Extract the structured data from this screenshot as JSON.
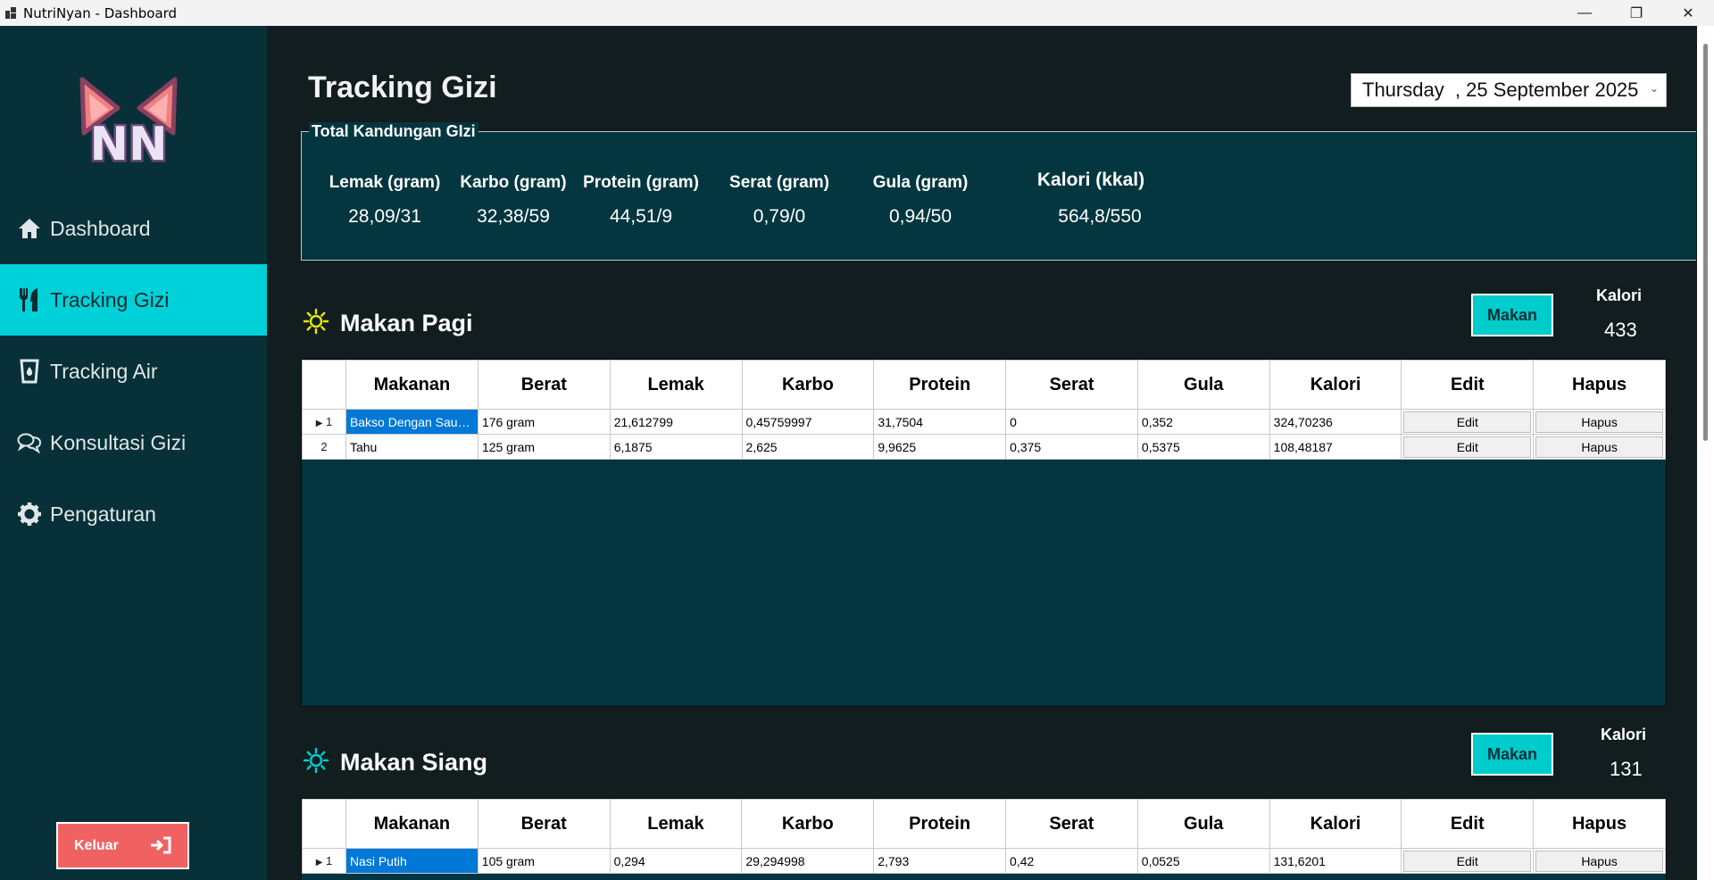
{
  "window": {
    "title": "NutriNyan - Dashboard",
    "minimize": "—",
    "maximize": "❐",
    "close": "✕"
  },
  "sidebar": {
    "logo_text": "NN",
    "items": [
      {
        "label": "Dashboard",
        "icon": "home-icon",
        "active": false
      },
      {
        "label": "Tracking Gizi",
        "icon": "utensils-icon",
        "active": true
      },
      {
        "label": "Tracking Air",
        "icon": "water-glass-icon",
        "active": false
      },
      {
        "label": "Konsultasi Gizi",
        "icon": "chat-icon",
        "active": false
      },
      {
        "label": "Pengaturan",
        "icon": "gear-icon",
        "active": false
      }
    ],
    "logout_label": "Keluar"
  },
  "main": {
    "title": "Tracking Gizi",
    "date": "Thursday  , 25 September 2025",
    "totals": {
      "legend": "Total Kandungan GIzi",
      "columns": [
        {
          "label": "Lemak (gram)",
          "value": "28,09/31"
        },
        {
          "label": "Karbo (gram)",
          "value": "32,38/59"
        },
        {
          "label": "Protein (gram)",
          "value": "44,51/9"
        },
        {
          "label": "Serat (gram)",
          "value": "0,79/0"
        },
        {
          "label": "Gula (gram)",
          "value": "0,94/50"
        },
        {
          "label": "Kalori (kkal)",
          "value": "564,8/550"
        }
      ]
    },
    "table_headers": [
      "Makanan",
      "Berat",
      "Lemak",
      "Karbo",
      "Protein",
      "Serat",
      "Gula",
      "Kalori",
      "Edit",
      "Hapus"
    ],
    "sections": [
      {
        "name": "Makan Pagi",
        "button": "Makan",
        "kalori_label": "Kalori",
        "kalori_value": "433",
        "icon_color": "#e6e600",
        "rows": [
          {
            "num": "1",
            "makanan": "Bakso Dengan Saus...",
            "berat": "176 gram",
            "lemak": "21,612799",
            "karbo": "0,45759997",
            "protein": "31,7504",
            "serat": "0",
            "gula": "0,352",
            "kalori": "324,70236",
            "edit": "Edit",
            "hapus": "Hapus"
          },
          {
            "num": "2",
            "makanan": "Tahu",
            "berat": "125 gram",
            "lemak": "6,1875",
            "karbo": "2,625",
            "protein": "9,9625",
            "serat": "0,375",
            "gula": "0,5375",
            "kalori": "108,48187",
            "edit": "Edit",
            "hapus": "Hapus"
          }
        ]
      },
      {
        "name": "Makan Siang",
        "button": "Makan",
        "kalori_label": "Kalori",
        "kalori_value": "131",
        "icon_color": "#00cccc",
        "rows": [
          {
            "num": "1",
            "makanan": "Nasi Putih",
            "berat": "105 gram",
            "lemak": "0,294",
            "karbo": "29,294998",
            "protein": "2,793",
            "serat": "0,42",
            "gula": "0,0525",
            "kalori": "131,6201",
            "edit": "Edit",
            "hapus": "Hapus"
          }
        ]
      }
    ]
  },
  "colors": {
    "sidebar_bg": "#083038",
    "accent": "#00d0d8",
    "main_bg": "#111d1f",
    "panel_bg": "#033540",
    "logout": "#f06262",
    "selection": "#0078d7"
  }
}
